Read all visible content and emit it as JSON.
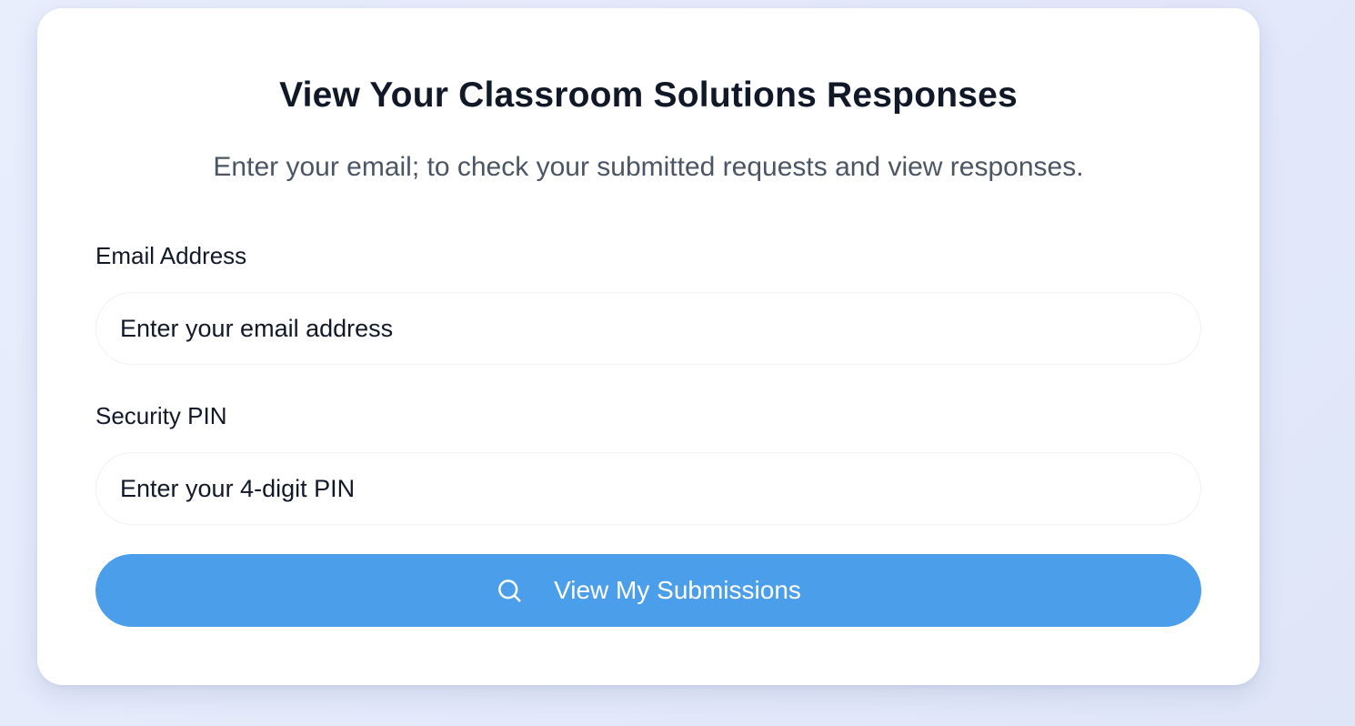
{
  "card": {
    "title": "View Your Classroom Solutions Responses",
    "subtitle": "Enter your email; to check your submitted requests and view responses."
  },
  "form": {
    "email": {
      "label": "Email Address",
      "placeholder": "Enter your email address",
      "value": ""
    },
    "pin": {
      "label": "Security PIN",
      "placeholder": "Enter your 4-digit PIN",
      "value": ""
    },
    "submit": {
      "label": "View My Submissions",
      "icon": "search-icon"
    }
  },
  "colors": {
    "accent": "#4b9eea",
    "title": "#111827",
    "subtitle": "#4b5563",
    "background": "#e6ecfb"
  }
}
